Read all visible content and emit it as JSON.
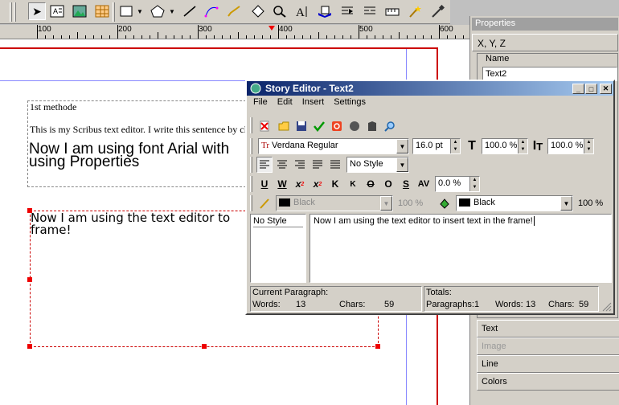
{
  "ruler": {
    "labels": [
      "100",
      "200",
      "300",
      "400",
      "500",
      "600"
    ]
  },
  "canvas": {
    "frame1": {
      "line1": "1st methode",
      "line2": "This is my Scribus text editor. I write this sentence by cl",
      "line3a": "Now I am using font Arial with",
      "line3b": "using Properties"
    },
    "frame2": {
      "line1": "Now I am using the text editor to",
      "line2": "frame!"
    }
  },
  "properties": {
    "title": "Properties",
    "xyz": "X, Y, Z",
    "name_label": "Name",
    "name_value": "Text2",
    "sections": [
      "Text",
      "Image",
      "Line",
      "Colors"
    ]
  },
  "story_editor": {
    "title": "Story Editor - Text2",
    "menu": [
      "File",
      "Edit",
      "Insert",
      "Settings"
    ],
    "font": "Verdana Regular",
    "font_size": "16.0 pt",
    "scale_h": "100.0 %",
    "scale_v": "100.0 %",
    "style": "No Style",
    "tracking": "0.0 %",
    "stroke_color": "Black",
    "stroke_shade": "100 %",
    "fill_color": "Black",
    "fill_shade": "100 %",
    "style_list": [
      "No Style"
    ],
    "text": "Now I am using the text editor to insert text in the frame!",
    "status": {
      "current_paragraph": "Current Paragraph:",
      "words_label": "Words:",
      "words": "13",
      "chars_label": "Chars:",
      "chars": "59",
      "totals": "Totals:",
      "paragraphs_label": "Paragraphs:",
      "paragraphs": "1",
      "total_words": "13",
      "total_chars": "59"
    }
  },
  "colors": {
    "titlebar": "#0a246a",
    "handle": "#e00000",
    "page_border": "#cc0000"
  }
}
